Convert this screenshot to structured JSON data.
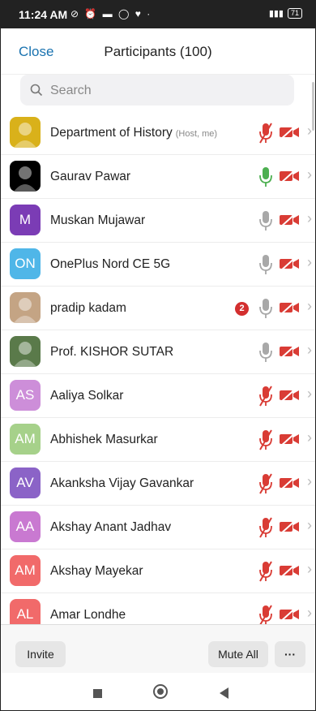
{
  "status_bar": {
    "time": "11:24 AM",
    "battery": "71"
  },
  "header": {
    "close_label": "Close",
    "title": "Participants (100)"
  },
  "search": {
    "placeholder": "Search"
  },
  "participants": [
    {
      "name": "Department of History",
      "tag": "(Host, me)",
      "avatar_type": "photo",
      "avatar_color": "#d9b11a",
      "mic": "muted",
      "cam": "off"
    },
    {
      "name": "Gaurav Pawar",
      "avatar_type": "photo",
      "avatar_color": "#000000",
      "mic": "active",
      "cam": "off"
    },
    {
      "name": "Muskan Mujawar",
      "initials": "M",
      "avatar_color": "#7b3cb5",
      "mic": "on",
      "cam": "off"
    },
    {
      "name": "OnePlus Nord CE 5G",
      "initials": "ON",
      "avatar_color": "#4fb6e8",
      "mic": "on",
      "cam": "off"
    },
    {
      "name": "pradip kadam",
      "avatar_type": "photo",
      "avatar_color": "#c4a484",
      "badge": "2",
      "mic": "on",
      "cam": "off"
    },
    {
      "name": "Prof. KISHOR SUTAR",
      "avatar_type": "photo",
      "avatar_color": "#5a7a4a",
      "mic": "on",
      "cam": "off"
    },
    {
      "name": "Aaliya Solkar",
      "initials": "AS",
      "avatar_color": "#cd8ed9",
      "mic": "muted",
      "cam": "off"
    },
    {
      "name": "Abhishek Masurkar",
      "initials": "AM",
      "avatar_color": "#a6d18a",
      "mic": "muted",
      "cam": "off"
    },
    {
      "name": "Akanksha Vijay Gavankar",
      "initials": "AV",
      "avatar_color": "#8b63c7",
      "mic": "muted",
      "cam": "off"
    },
    {
      "name": "Akshay Anant Jadhav",
      "initials": "AA",
      "avatar_color": "#c979d1",
      "mic": "muted",
      "cam": "off"
    },
    {
      "name": "Akshay Mayekar",
      "initials": "AM",
      "avatar_color": "#f16a6a",
      "mic": "muted",
      "cam": "off"
    },
    {
      "name": "Amar Londhe",
      "initials": "AL",
      "avatar_color": "#f16a6a",
      "mic": "muted",
      "cam": "off"
    }
  ],
  "bottom_bar": {
    "invite_label": "Invite",
    "mute_all_label": "Mute All",
    "more_label": "···"
  },
  "colors": {
    "accent": "#1a73b0",
    "muted_red": "#d93c35",
    "mic_gray": "#a8a8a8",
    "mic_active": "#4caf50"
  },
  "icons": {
    "search": "search-icon",
    "mic": "microphone-icon",
    "camera": "video-off-icon",
    "chevron": "chevron-right-icon"
  }
}
